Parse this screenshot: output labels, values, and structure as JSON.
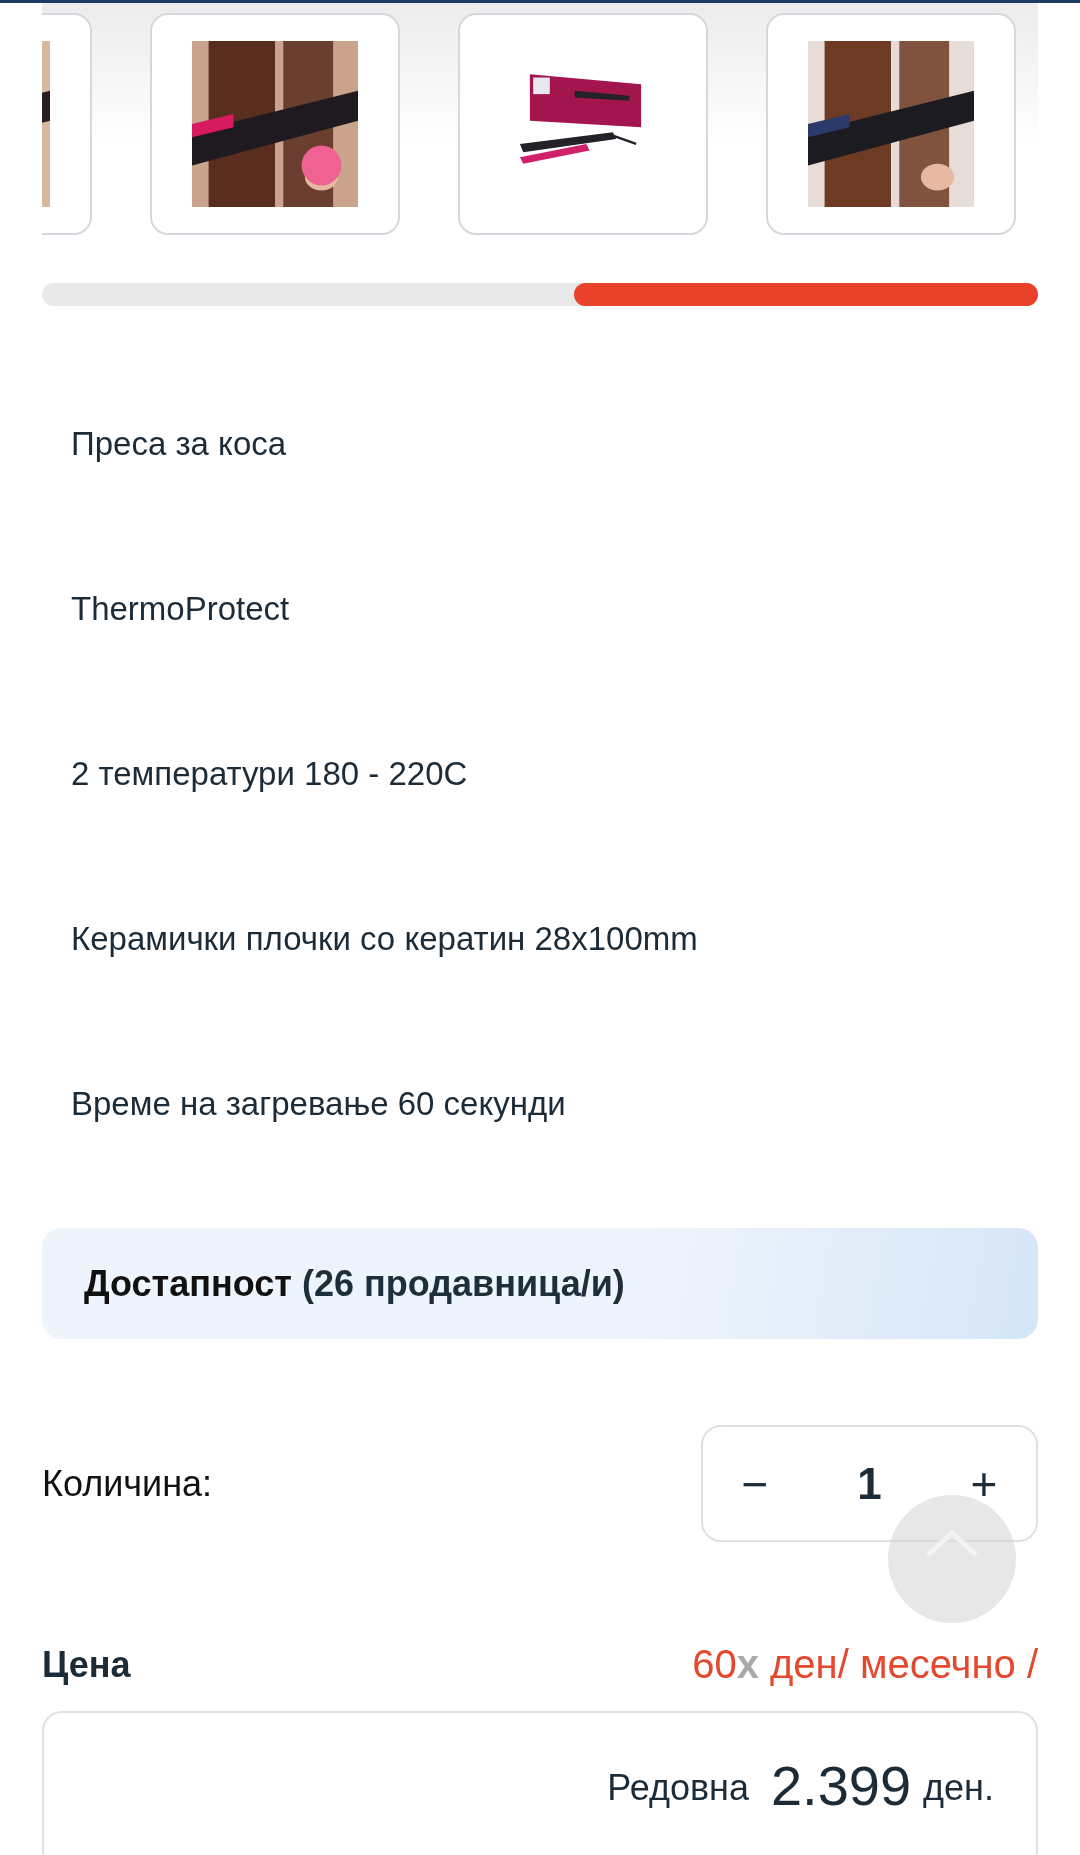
{
  "features": [
    "Преса за коса",
    "ThermoProtect",
    "2 температури 180 - 220C",
    "Керамички плочки со кератин 28x100mm",
    "Време на загревање 60 секунди"
  ],
  "availability": {
    "label": "Достапност",
    "count": "(26 продавница/и)"
  },
  "quantity": {
    "label": "Количина:",
    "decrement": "−",
    "value": "1",
    "increment": "+"
  },
  "price": {
    "heading": "Цена",
    "installments": "60",
    "times": "x",
    "installment_unit": "ден/ месечно /",
    "regular_label": "Редовна",
    "regular_amount": "2.399",
    "currency": "ден."
  }
}
